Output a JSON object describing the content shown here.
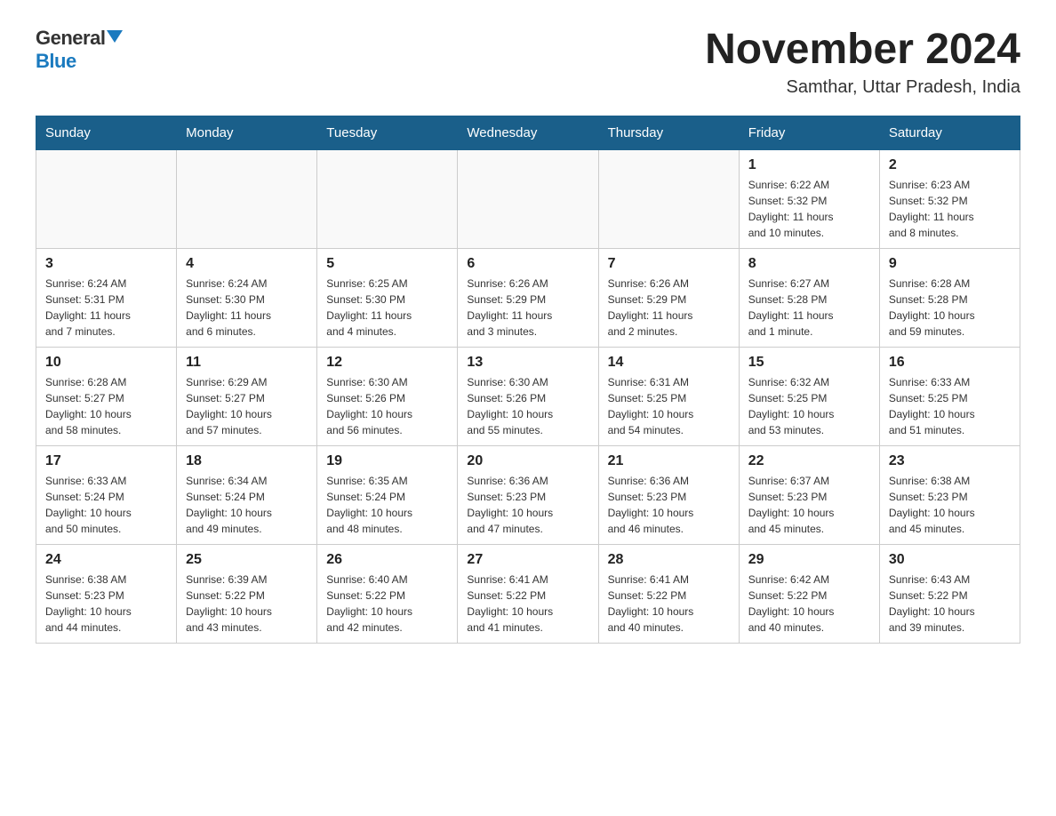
{
  "logo": {
    "general": "General",
    "blue": "Blue"
  },
  "title": {
    "month_year": "November 2024",
    "location": "Samthar, Uttar Pradesh, India"
  },
  "weekdays": [
    "Sunday",
    "Monday",
    "Tuesday",
    "Wednesday",
    "Thursday",
    "Friday",
    "Saturday"
  ],
  "weeks": [
    [
      {
        "day": "",
        "info": ""
      },
      {
        "day": "",
        "info": ""
      },
      {
        "day": "",
        "info": ""
      },
      {
        "day": "",
        "info": ""
      },
      {
        "day": "",
        "info": ""
      },
      {
        "day": "1",
        "info": "Sunrise: 6:22 AM\nSunset: 5:32 PM\nDaylight: 11 hours\nand 10 minutes."
      },
      {
        "day": "2",
        "info": "Sunrise: 6:23 AM\nSunset: 5:32 PM\nDaylight: 11 hours\nand 8 minutes."
      }
    ],
    [
      {
        "day": "3",
        "info": "Sunrise: 6:24 AM\nSunset: 5:31 PM\nDaylight: 11 hours\nand 7 minutes."
      },
      {
        "day": "4",
        "info": "Sunrise: 6:24 AM\nSunset: 5:30 PM\nDaylight: 11 hours\nand 6 minutes."
      },
      {
        "day": "5",
        "info": "Sunrise: 6:25 AM\nSunset: 5:30 PM\nDaylight: 11 hours\nand 4 minutes."
      },
      {
        "day": "6",
        "info": "Sunrise: 6:26 AM\nSunset: 5:29 PM\nDaylight: 11 hours\nand 3 minutes."
      },
      {
        "day": "7",
        "info": "Sunrise: 6:26 AM\nSunset: 5:29 PM\nDaylight: 11 hours\nand 2 minutes."
      },
      {
        "day": "8",
        "info": "Sunrise: 6:27 AM\nSunset: 5:28 PM\nDaylight: 11 hours\nand 1 minute."
      },
      {
        "day": "9",
        "info": "Sunrise: 6:28 AM\nSunset: 5:28 PM\nDaylight: 10 hours\nand 59 minutes."
      }
    ],
    [
      {
        "day": "10",
        "info": "Sunrise: 6:28 AM\nSunset: 5:27 PM\nDaylight: 10 hours\nand 58 minutes."
      },
      {
        "day": "11",
        "info": "Sunrise: 6:29 AM\nSunset: 5:27 PM\nDaylight: 10 hours\nand 57 minutes."
      },
      {
        "day": "12",
        "info": "Sunrise: 6:30 AM\nSunset: 5:26 PM\nDaylight: 10 hours\nand 56 minutes."
      },
      {
        "day": "13",
        "info": "Sunrise: 6:30 AM\nSunset: 5:26 PM\nDaylight: 10 hours\nand 55 minutes."
      },
      {
        "day": "14",
        "info": "Sunrise: 6:31 AM\nSunset: 5:25 PM\nDaylight: 10 hours\nand 54 minutes."
      },
      {
        "day": "15",
        "info": "Sunrise: 6:32 AM\nSunset: 5:25 PM\nDaylight: 10 hours\nand 53 minutes."
      },
      {
        "day": "16",
        "info": "Sunrise: 6:33 AM\nSunset: 5:25 PM\nDaylight: 10 hours\nand 51 minutes."
      }
    ],
    [
      {
        "day": "17",
        "info": "Sunrise: 6:33 AM\nSunset: 5:24 PM\nDaylight: 10 hours\nand 50 minutes."
      },
      {
        "day": "18",
        "info": "Sunrise: 6:34 AM\nSunset: 5:24 PM\nDaylight: 10 hours\nand 49 minutes."
      },
      {
        "day": "19",
        "info": "Sunrise: 6:35 AM\nSunset: 5:24 PM\nDaylight: 10 hours\nand 48 minutes."
      },
      {
        "day": "20",
        "info": "Sunrise: 6:36 AM\nSunset: 5:23 PM\nDaylight: 10 hours\nand 47 minutes."
      },
      {
        "day": "21",
        "info": "Sunrise: 6:36 AM\nSunset: 5:23 PM\nDaylight: 10 hours\nand 46 minutes."
      },
      {
        "day": "22",
        "info": "Sunrise: 6:37 AM\nSunset: 5:23 PM\nDaylight: 10 hours\nand 45 minutes."
      },
      {
        "day": "23",
        "info": "Sunrise: 6:38 AM\nSunset: 5:23 PM\nDaylight: 10 hours\nand 45 minutes."
      }
    ],
    [
      {
        "day": "24",
        "info": "Sunrise: 6:38 AM\nSunset: 5:23 PM\nDaylight: 10 hours\nand 44 minutes."
      },
      {
        "day": "25",
        "info": "Sunrise: 6:39 AM\nSunset: 5:22 PM\nDaylight: 10 hours\nand 43 minutes."
      },
      {
        "day": "26",
        "info": "Sunrise: 6:40 AM\nSunset: 5:22 PM\nDaylight: 10 hours\nand 42 minutes."
      },
      {
        "day": "27",
        "info": "Sunrise: 6:41 AM\nSunset: 5:22 PM\nDaylight: 10 hours\nand 41 minutes."
      },
      {
        "day": "28",
        "info": "Sunrise: 6:41 AM\nSunset: 5:22 PM\nDaylight: 10 hours\nand 40 minutes."
      },
      {
        "day": "29",
        "info": "Sunrise: 6:42 AM\nSunset: 5:22 PM\nDaylight: 10 hours\nand 40 minutes."
      },
      {
        "day": "30",
        "info": "Sunrise: 6:43 AM\nSunset: 5:22 PM\nDaylight: 10 hours\nand 39 minutes."
      }
    ]
  ]
}
